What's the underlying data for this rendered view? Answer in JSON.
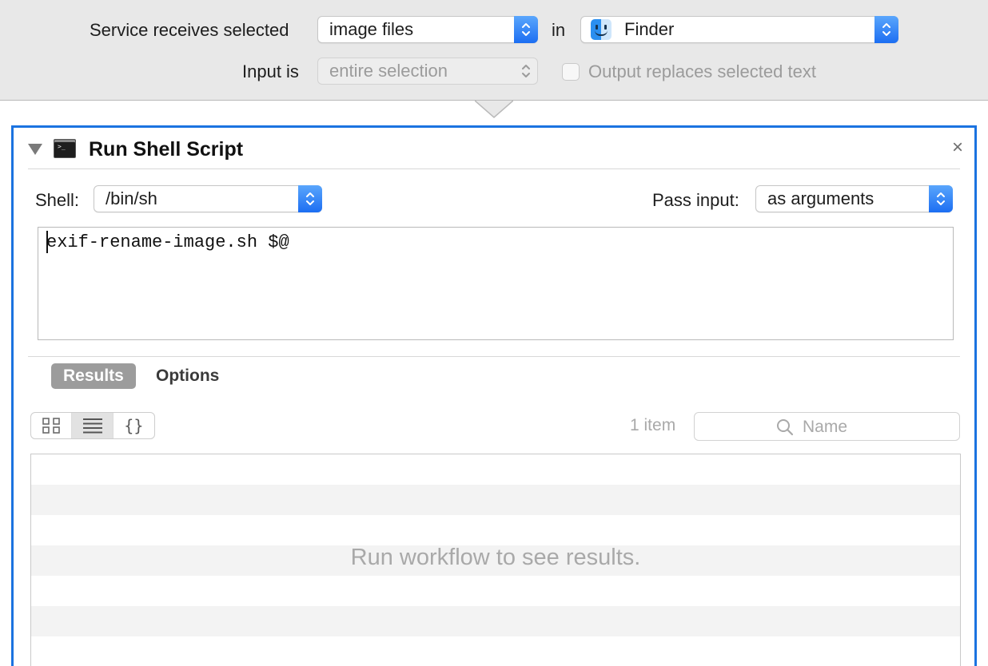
{
  "service": {
    "receives_label": "Service receives selected",
    "receives_value": "image files",
    "in_label": "in",
    "app_value": "Finder",
    "input_label": "Input is",
    "input_value": "entire selection",
    "output_replaces_label": "Output replaces selected text",
    "output_replaces_checked": false
  },
  "action": {
    "title": "Run Shell Script",
    "close_glyph": "×",
    "shell_label": "Shell:",
    "shell_value": "/bin/sh",
    "pass_input_label": "Pass input:",
    "pass_input_value": "as arguments",
    "script": "exif-rename-image.sh $@",
    "tabs": [
      {
        "label": "Results",
        "active": true
      },
      {
        "label": "Options",
        "active": false
      }
    ],
    "view_modes": [
      "grid-icon",
      "list-icon",
      "json-icon"
    ],
    "view_mode_selected": "list-icon",
    "json_glyph": "{}",
    "item_count": "1 item",
    "search_placeholder": "Name",
    "empty_message": "Run workflow to see results."
  },
  "colors": {
    "accent_blue": "#1b73e0",
    "toolbar_bg": "#e8e8e8",
    "tab_active_bg": "#9c9c9c"
  }
}
